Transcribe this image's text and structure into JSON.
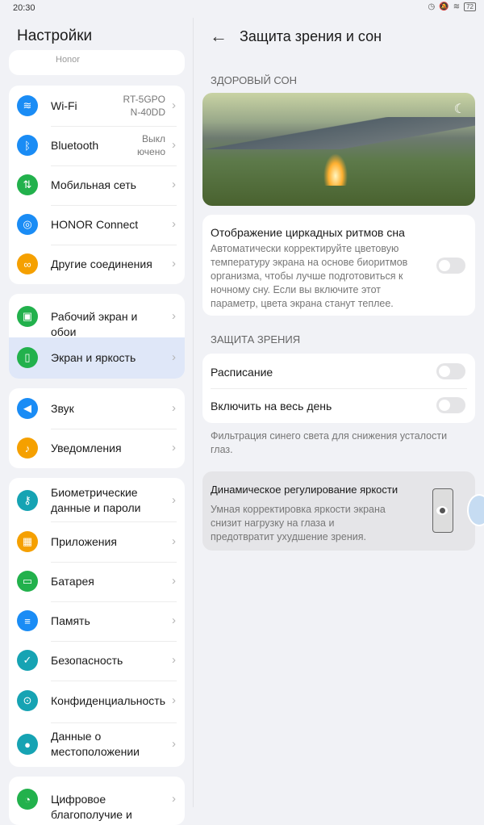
{
  "status": {
    "time": "20:30",
    "battery": "72"
  },
  "left": {
    "title": "Настройки",
    "partial_item": "Honor",
    "groups": [
      [
        {
          "label": "Wi-Fi",
          "value": "RT-5GPO N-40DD",
          "icon": "wifi-icon",
          "color": "#1a8cf5"
        },
        {
          "label": "Bluetooth",
          "value": "Выкл ючено",
          "icon": "bluetooth-icon",
          "color": "#1a8cf5"
        },
        {
          "label": "Мобильная сеть",
          "icon": "mobile-network-icon",
          "color": "#22b14c"
        },
        {
          "label": "HONOR Connect",
          "icon": "honor-connect-icon",
          "color": "#1a8cf5"
        },
        {
          "label": "Другие соединения",
          "icon": "link-icon",
          "color": "#f5a000"
        }
      ],
      [
        {
          "label": "Рабочий экран и обои",
          "icon": "wallpaper-icon",
          "color": "#22b14c"
        },
        {
          "label": "Экран и яркость",
          "icon": "display-icon",
          "color": "#22b14c",
          "selected": true
        }
      ],
      [
        {
          "label": "Звук",
          "icon": "sound-icon",
          "color": "#1a8cf5"
        },
        {
          "label": "Уведомления",
          "icon": "bell-icon",
          "color": "#f5a000"
        }
      ],
      [
        {
          "label": "Биометрические данные и пароли",
          "icon": "key-icon",
          "color": "#16a3b3"
        },
        {
          "label": "Приложения",
          "icon": "apps-icon",
          "color": "#f5a000"
        },
        {
          "label": "Батарея",
          "icon": "battery-icon",
          "color": "#22b14c"
        },
        {
          "label": "Память",
          "icon": "storage-icon",
          "color": "#1a8cf5"
        },
        {
          "label": "Безопасность",
          "icon": "shield-icon",
          "color": "#16a3b3"
        },
        {
          "label": "Конфиденциальность",
          "icon": "privacy-icon",
          "color": "#16a3b3"
        },
        {
          "label": "Данные о местоположении",
          "icon": "location-icon",
          "color": "#16a3b3"
        }
      ],
      [
        {
          "label": "Цифровое благополучие и",
          "icon": "wellbeing-icon",
          "color": "#22b14c"
        }
      ]
    ]
  },
  "right": {
    "title": "Защита зрения и сон",
    "sleep_section": "ЗДОРОВЫЙ СОН",
    "circadian": {
      "title": "Отображение циркадных ритмов сна",
      "desc": "Автоматически корректируйте цветовую температуру экрана на основе биоритмов организма, чтобы лучше подготовиться к ночному сну. Если вы включите этот параметр, цвета экрана станут теплее.",
      "on": false
    },
    "eye_section": "ЗАЩИТА ЗРЕНИЯ",
    "schedule": {
      "label": "Расписание",
      "on": false
    },
    "all_day": {
      "label": "Включить на весь день",
      "on": false
    },
    "footnote": "Фильтрация синего света для снижения усталости глаз.",
    "dynamic": {
      "title": "Динамическое регулирование яркости",
      "desc": "Умная корректировка яркости экрана снизит нагрузку на глаза и предотвратит ухудшение зрения."
    }
  }
}
